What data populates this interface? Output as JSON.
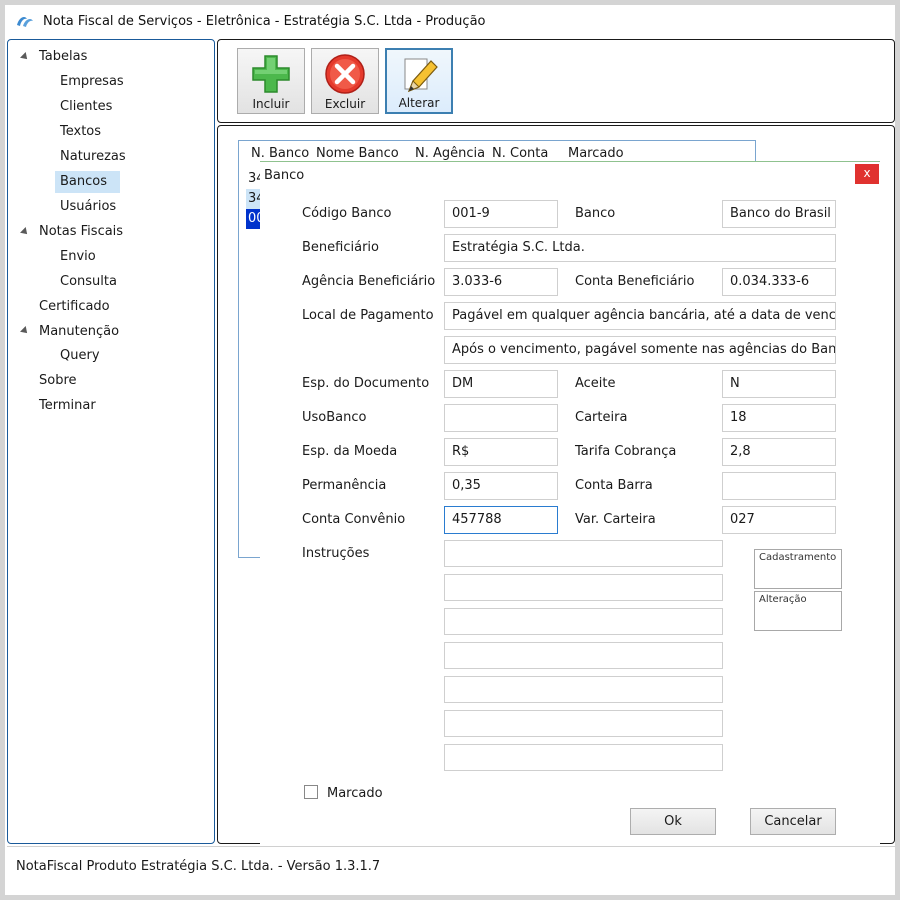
{
  "window": {
    "title": "Nota Fiscal de Serviços - Eletrônica - Estratégia S.C. Ltda - Produção"
  },
  "sidebar": {
    "items": [
      {
        "label": "Tabelas",
        "expanded": true
      },
      {
        "label": "Empresas"
      },
      {
        "label": "Clientes"
      },
      {
        "label": "Textos"
      },
      {
        "label": "Naturezas"
      },
      {
        "label": "Bancos",
        "selected": true
      },
      {
        "label": "Usuários"
      },
      {
        "label": "Notas Fiscais",
        "expanded": true
      },
      {
        "label": "Envio"
      },
      {
        "label": "Consulta"
      },
      {
        "label": "Certificado"
      },
      {
        "label": "Manutenção",
        "expanded": true
      },
      {
        "label": "Query"
      },
      {
        "label": "Sobre"
      },
      {
        "label": "Terminar"
      }
    ]
  },
  "toolbar": {
    "incluir": "Incluir",
    "excluir": "Excluir",
    "alterar": "Alterar"
  },
  "grid": {
    "columns": [
      "N. Banco",
      "Nome Banco",
      "N. Agência",
      "N. Conta",
      "Marcado"
    ],
    "rows": [
      "34",
      "34",
      "00"
    ]
  },
  "dialog": {
    "title": "Banco",
    "close": "x",
    "labels": {
      "codigo_banco": "Código Banco",
      "banco": "Banco",
      "beneficiario": "Beneficiário",
      "agencia_beneficiario": "Agência Beneficiário",
      "conta_beneficiario": "Conta Beneficiário",
      "local_pagamento": "Local de Pagamento",
      "esp_documento": "Esp. do Documento",
      "aceite": "Aceite",
      "uso_banco": "UsoBanco",
      "carteira": "Carteira",
      "esp_moeda": "Esp. da Moeda",
      "tarifa_cobranca": "Tarifa Cobrança",
      "permanencia": "Permanência",
      "conta_barra": "Conta Barra",
      "conta_convenio": "Conta Convênio",
      "var_carteira": "Var. Carteira",
      "instrucoes": "Instruções",
      "cadastramento": "Cadastramento",
      "alteracao": "Alteração",
      "marcado": "Marcado"
    },
    "values": {
      "codigo_banco": "001-9",
      "banco": "Banco do Brasil",
      "beneficiario": "Estratégia S.C. Ltda.",
      "agencia_beneficiario": "3.033-6",
      "conta_beneficiario": "0.034.333-6",
      "local_pagamento_1": "Pagável em qualquer agência bancária, até a data de venciment",
      "local_pagamento_2": "Após o vencimento, pagável somente nas agências do Banco do",
      "esp_documento": "DM",
      "aceite": "N",
      "uso_banco": "",
      "carteira": "18",
      "esp_moeda": "R$",
      "tarifa_cobranca": "2,8",
      "permanencia": "0,35",
      "conta_barra": "",
      "conta_convenio": "457788",
      "var_carteira": "027"
    },
    "buttons": {
      "ok": "Ok",
      "cancelar": "Cancelar"
    }
  },
  "statusbar": {
    "text": "NotaFiscal Produto Estratégia S.C. Ltda. -  Versão 1.3.1.7"
  }
}
